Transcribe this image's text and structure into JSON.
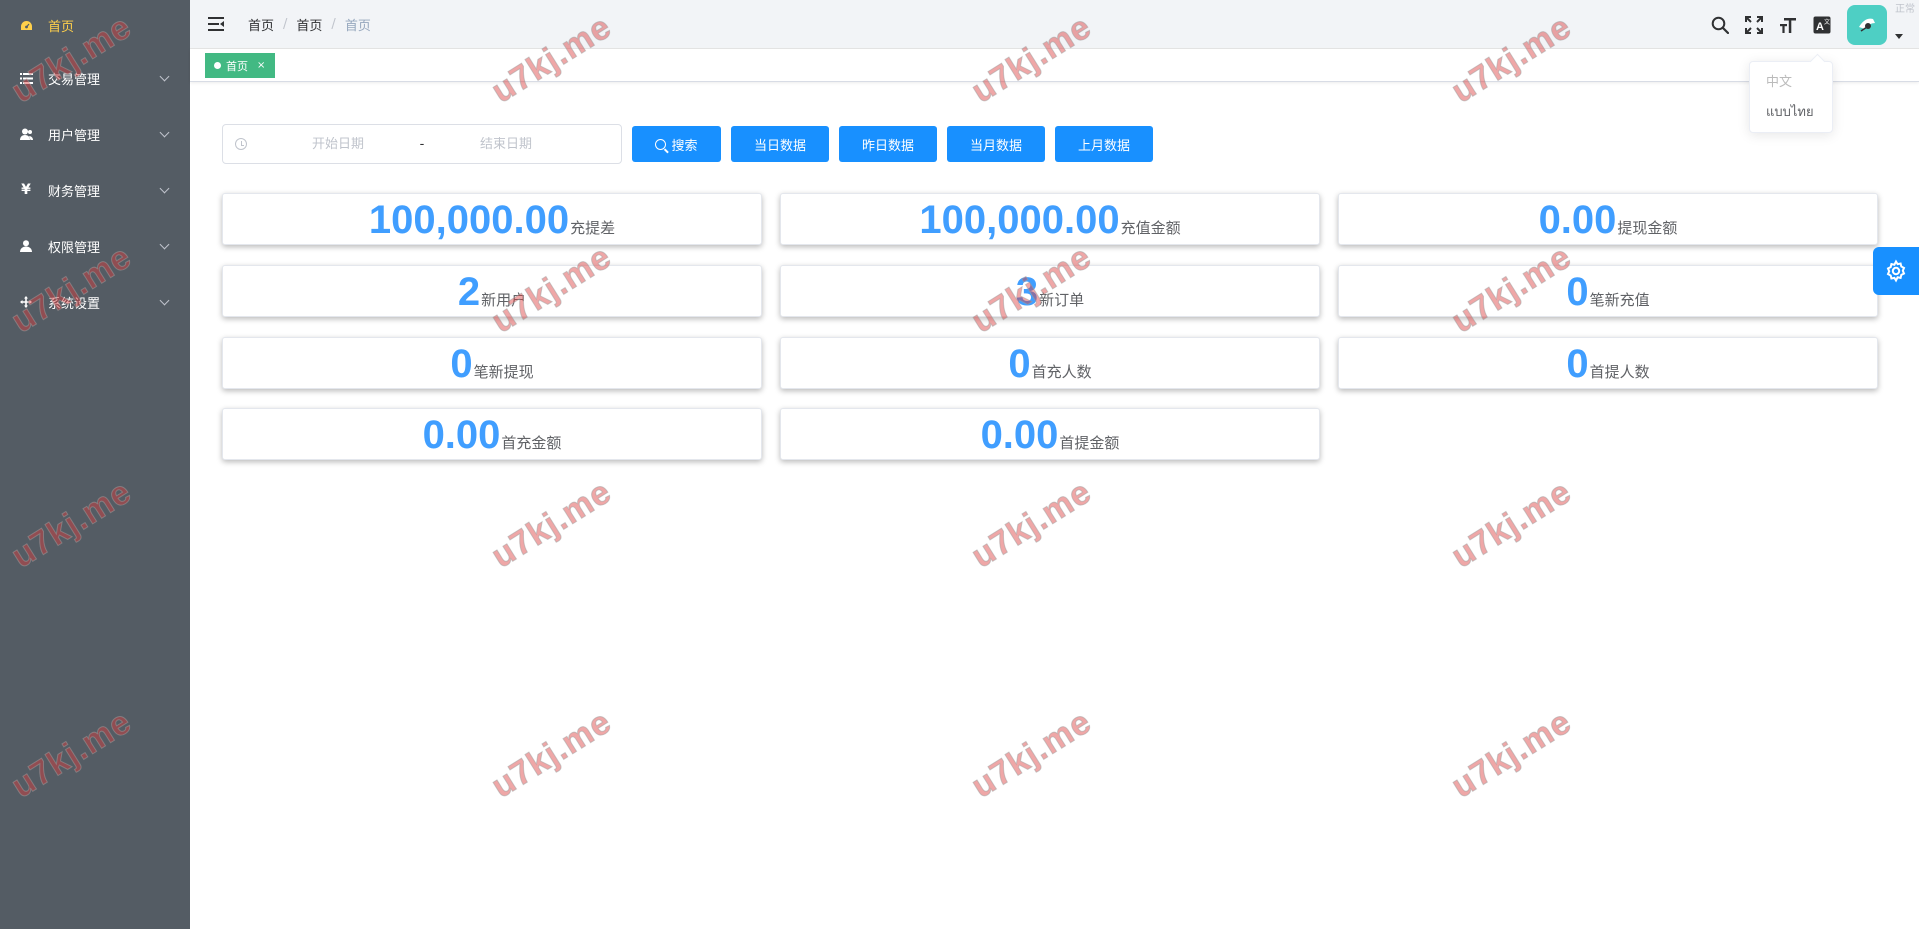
{
  "sidebar": {
    "items": [
      {
        "label": "首页",
        "icon": "dashboard-icon",
        "active": true
      },
      {
        "label": "交易管理",
        "icon": "list-icon"
      },
      {
        "label": "用户管理",
        "icon": "users-icon"
      },
      {
        "label": "财务管理",
        "icon": "yen-icon"
      },
      {
        "label": "权限管理",
        "icon": "user-icon"
      },
      {
        "label": "系统设置",
        "icon": "move-icon"
      }
    ]
  },
  "header": {
    "breadcrumb": [
      "首页",
      "首页",
      "首页"
    ],
    "corner_text": "正常"
  },
  "tags": [
    {
      "label": "首页",
      "close": "×"
    }
  ],
  "language_dropdown": {
    "options": [
      {
        "label": "中文",
        "disabled": true
      },
      {
        "label": "แบบไทย",
        "disabled": false
      }
    ]
  },
  "search": {
    "start_placeholder": "开始日期",
    "end_placeholder": "结束日期",
    "separator": "-",
    "search_label": "搜索",
    "today_label": "当日数据",
    "yesterday_label": "昨日数据",
    "this_month_label": "当月数据",
    "last_month_label": "上月数据"
  },
  "stats": [
    {
      "value": "100,000.00",
      "label": "充提差"
    },
    {
      "value": "100,000.00",
      "label": "充值金额"
    },
    {
      "value": "0.00",
      "label": "提现金额"
    },
    {
      "value": "2",
      "label": "新用户"
    },
    {
      "value": "3",
      "label": "新订单"
    },
    {
      "value": "0",
      "label": "笔新充值"
    },
    {
      "value": "0",
      "label": "笔新提现"
    },
    {
      "value": "0",
      "label": "首充人数"
    },
    {
      "value": "0",
      "label": "首提人数"
    },
    {
      "value": "0.00",
      "label": "首充金额"
    },
    {
      "value": "0.00",
      "label": "首提金额"
    }
  ],
  "watermark": "u7kj.me",
  "colors": {
    "sidebar_bg": "#545c64",
    "active_menu": "#ffd04b",
    "primary": "#1890ff",
    "stat_value": "#409eff",
    "tag": "#42b983"
  }
}
